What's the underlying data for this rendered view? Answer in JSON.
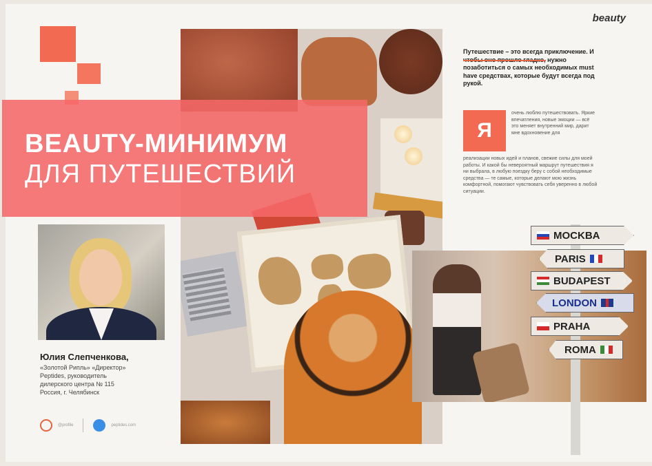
{
  "header": {
    "tag": "beauty"
  },
  "title": {
    "line1": "BEAUTY-МИНИМУМ",
    "line2": "ДЛЯ ПУТЕШЕСТВИЙ"
  },
  "author": {
    "name": "Юлия Слепченкова,",
    "info_lines": [
      "«Золотой Рипль» «Директор»",
      "Peptides, руководитель",
      "дилерского центра № 115",
      "Россия, г. Челябинск"
    ]
  },
  "social": {
    "instagram": "@profile",
    "site": "peptides.com"
  },
  "article": {
    "lead": "Путешествие – это всегда приключение. И чтобы оно прошло гладко, нужно позаботиться о самых необходимых must have средствах, которые будут всегда под рукой.",
    "dropcap": "Я",
    "body_top": "очень люблю путешествовать. Яркие впечатления, новые эмоции — всё это меняет внутренний мир, дарит мне вдохновение для",
    "body_bottom": "реализации новых идей и планов, свежие силы для моей работы. И какой бы невероятный маршрут путешествия я ни выбрала, в любую поездку беру с собой необходимые средства — те самые, которые делают мою жизнь комфортной, помогают чувствовать себя уверенно в любой ситуации."
  },
  "signs": [
    {
      "text": "MOCKBA",
      "flag": "russia"
    },
    {
      "text": "PARIS",
      "flag": "france"
    },
    {
      "text": "BUDAPEST",
      "flag": "hungary"
    },
    {
      "text": "LONDON",
      "flag": "uk"
    },
    {
      "text": "PRAHA",
      "flag": "czech"
    },
    {
      "text": "ROMA",
      "flag": "italy"
    }
  ],
  "colors": {
    "accent": "#f26a52",
    "banner": "#f56868"
  }
}
